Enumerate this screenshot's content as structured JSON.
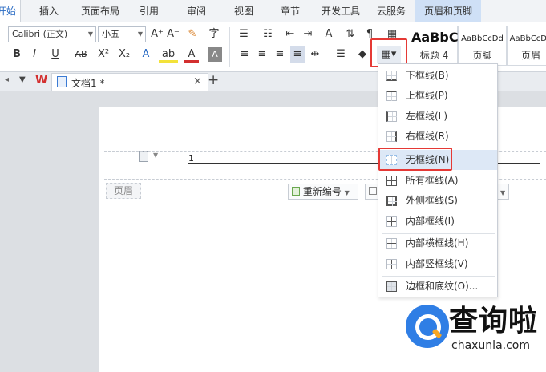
{
  "ribbon_tabs": [
    "开始",
    "插入",
    "页面布局",
    "引用",
    "审阅",
    "视图",
    "章节",
    "开发工具",
    "云服务",
    "页眉和页脚"
  ],
  "toolbar": {
    "font_name": "Calibri (正文)",
    "font_size": "小五",
    "bold": "B",
    "italic": "I",
    "underline": "U",
    "strike": "AB",
    "superscript": "X²",
    "subscript": "X₂",
    "grow_font": "A⁺",
    "shrink_font": "A⁻"
  },
  "styles": [
    {
      "sample": "AaBbC",
      "name": "标题 4"
    },
    {
      "sample": "AaBbCcDd",
      "name": "页脚"
    },
    {
      "sample": "AaBbCcDd",
      "name": "页眉"
    }
  ],
  "doc_tab": {
    "app_logo": "W",
    "title": "文档1 *",
    "close": "×",
    "new": "+"
  },
  "page": {
    "header_number": "1",
    "header_label": "页眉",
    "renumber_label": "重新编号"
  },
  "border_menu": [
    {
      "label": "下框线(B)",
      "icon": "border-bottom-icon"
    },
    {
      "label": "上框线(P)",
      "icon": "border-top-icon"
    },
    {
      "label": "左框线(L)",
      "icon": "border-left-icon"
    },
    {
      "label": "右框线(R)",
      "icon": "border-right-icon"
    },
    {
      "label": "无框线(N)",
      "icon": "border-none-icon"
    },
    {
      "label": "所有框线(A)",
      "icon": "border-all-icon"
    },
    {
      "label": "外侧框线(S)",
      "icon": "border-outer-icon"
    },
    {
      "label": "内部框线(I)",
      "icon": "border-inner-icon"
    },
    {
      "label": "内部横框线(H)",
      "icon": "border-inner-horizontal-icon"
    },
    {
      "label": "内部竖框线(V)",
      "icon": "border-inner-vertical-icon"
    },
    {
      "label": "边框和底纹(O)...",
      "icon": "borders-shading-icon"
    }
  ],
  "watermark": {
    "title": "查询啦",
    "url": "chaxunla.com"
  },
  "colors": {
    "accent": "#2b6cc4",
    "highlight_box": "#e53935",
    "menu_hover": "#dde8f6"
  }
}
